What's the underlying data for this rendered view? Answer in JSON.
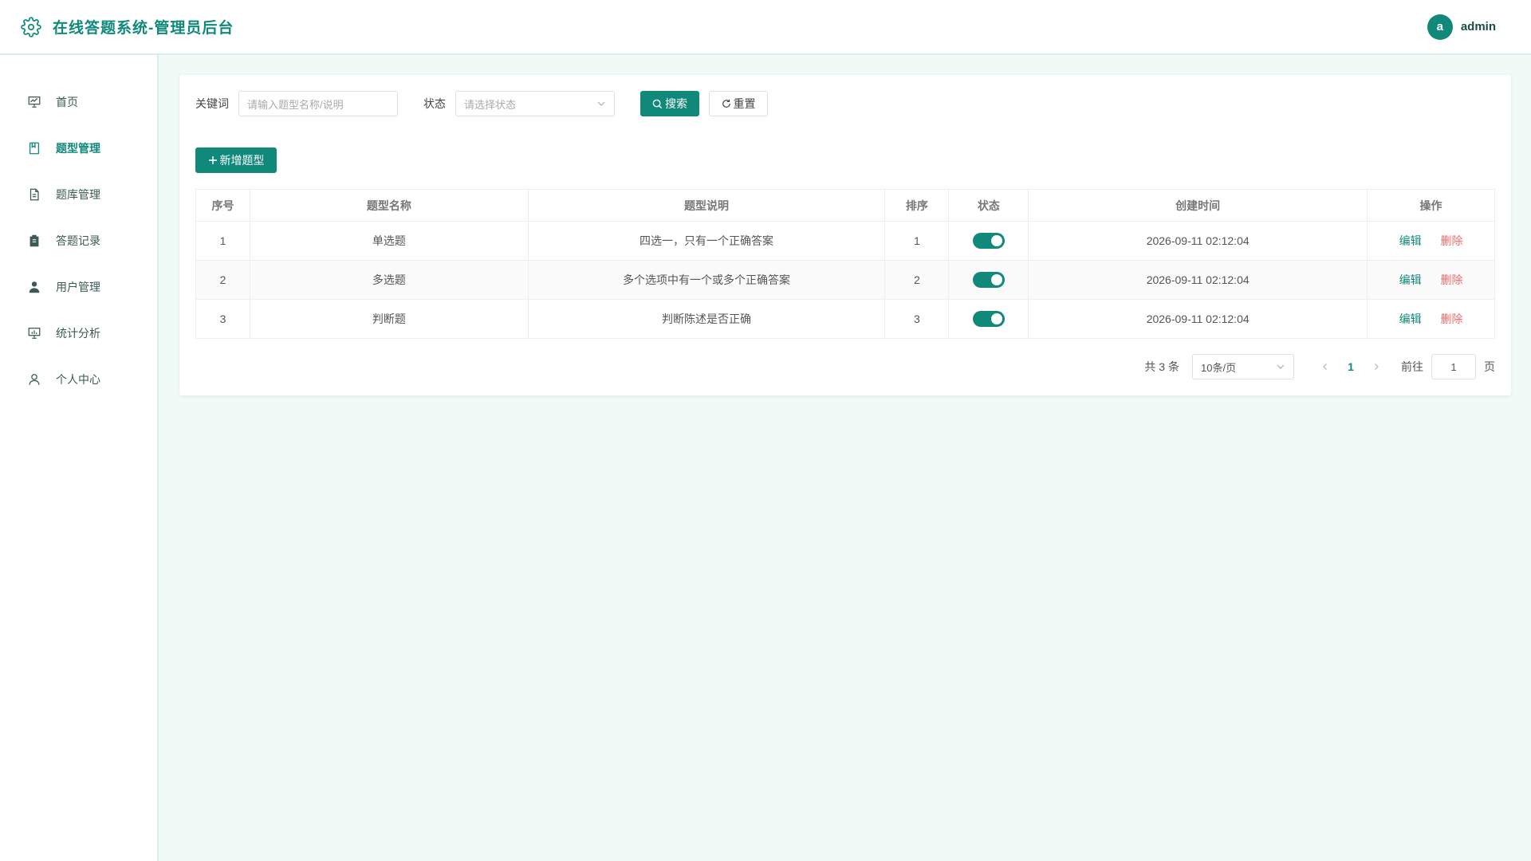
{
  "header": {
    "title": "在线答题系统-管理员后台",
    "avatar_letter": "a",
    "username": "admin",
    "accent_color": "#11897a"
  },
  "sidebar": {
    "items": [
      {
        "label": "首页",
        "icon": "presentation-icon",
        "active": false
      },
      {
        "label": "题型管理",
        "icon": "notebook-icon",
        "active": true
      },
      {
        "label": "题库管理",
        "icon": "document-icon",
        "active": false
      },
      {
        "label": "答题记录",
        "icon": "clipboard-icon",
        "active": false
      },
      {
        "label": "用户管理",
        "icon": "user-filled-icon",
        "active": false
      },
      {
        "label": "统计分析",
        "icon": "chart-board-icon",
        "active": false
      },
      {
        "label": "个人中心",
        "icon": "user-outline-icon",
        "active": false
      }
    ]
  },
  "search": {
    "keyword_label": "关键词",
    "keyword_placeholder": "请输入题型名称/说明",
    "status_label": "状态",
    "status_placeholder": "请选择状态",
    "search_button": "搜索",
    "reset_button": "重置"
  },
  "add_button": "新增题型",
  "table": {
    "headers": [
      "序号",
      "题型名称",
      "题型说明",
      "排序",
      "状态",
      "创建时间",
      "操作"
    ],
    "rows": [
      {
        "index": "1",
        "name": "单选题",
        "desc": "四选一，只有一个正确答案",
        "sort": "1",
        "status_on": true,
        "created": "2026-09-11 02:12:04",
        "edit": "编辑",
        "delete": "删除"
      },
      {
        "index": "2",
        "name": "多选题",
        "desc": "多个选项中有一个或多个正确答案",
        "sort": "2",
        "status_on": true,
        "created": "2026-09-11 02:12:04",
        "edit": "编辑",
        "delete": "删除"
      },
      {
        "index": "3",
        "name": "判断题",
        "desc": "判断陈述是否正确",
        "sort": "3",
        "status_on": true,
        "created": "2026-09-11 02:12:04",
        "edit": "编辑",
        "delete": "删除"
      }
    ]
  },
  "pagination": {
    "total_text": "共 3 条",
    "page_size": "10条/页",
    "current_page": "1",
    "goto_label": "前往",
    "goto_value": "1",
    "page_suffix": "页"
  }
}
